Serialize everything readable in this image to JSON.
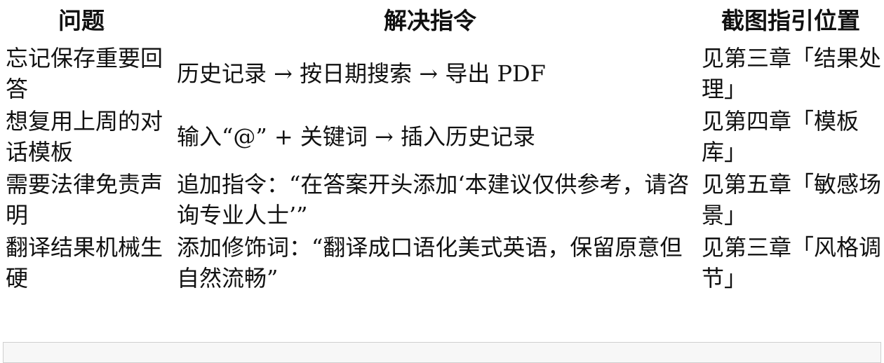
{
  "table": {
    "headers": {
      "issue": "问题",
      "command": "解决指令",
      "reference": "截图指引位置"
    },
    "rows": [
      {
        "issue": "忘记保存重要回答",
        "command": "历史记录 → 按日期搜索 → 导出 PDF",
        "reference": "见第三章「结果处理」"
      },
      {
        "issue": "想复用上周的对话模板",
        "command": "输入“@” + 关键词 → 插入历史记录",
        "reference": "见第四章「模板库」"
      },
      {
        "issue": "需要法律免责声明",
        "command": "追加指令：“在答案开头添加‘本建议仅供参考，请咨询专业人士’”",
        "reference": "见第五章「敏感场景」"
      },
      {
        "issue": "翻译结果机械生硬",
        "command": "添加修饰词：“翻译成口语化美式英语，保留原意但自然流畅”",
        "reference": "见第三章「风格调节」"
      }
    ]
  }
}
